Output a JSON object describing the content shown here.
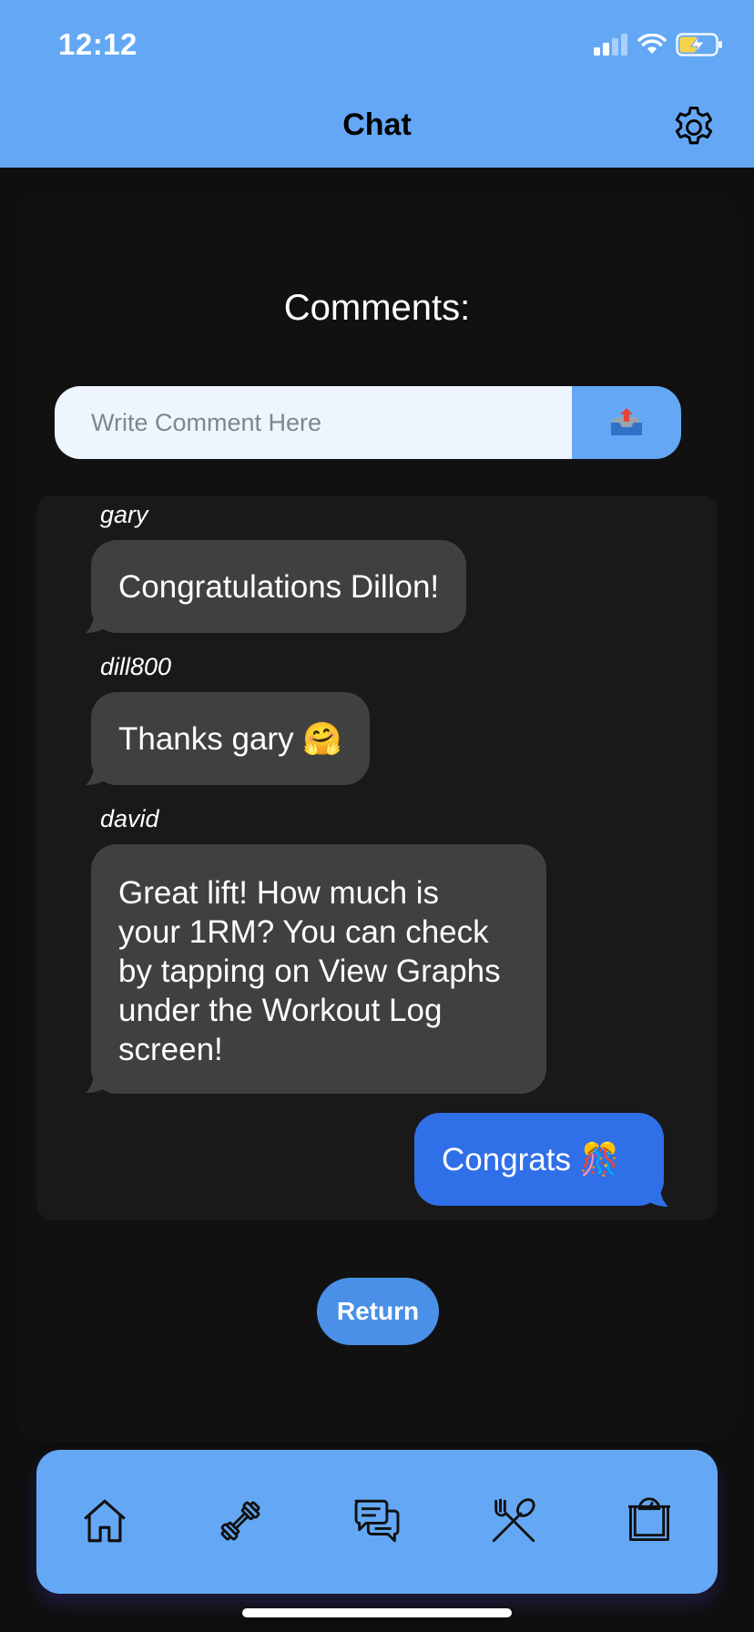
{
  "status_bar": {
    "time": "12:12"
  },
  "header": {
    "title": "Chat",
    "settings_icon": "gear-icon"
  },
  "comments": {
    "heading": "Comments:",
    "composer": {
      "placeholder": "Write Comment Here",
      "value": "",
      "send_icon": "outbox-tray-icon"
    },
    "messages": [
      {
        "author": "gary",
        "text": "Congratulations Dillon!",
        "direction": "incoming"
      },
      {
        "author": "dill800",
        "text": "Thanks gary 🤗",
        "direction": "incoming"
      },
      {
        "author": "david",
        "lines": [
          "Great lift! How much is",
          "your 1RM? You can check",
          "by tapping on View Graphs",
          "under the Workout Log",
          "screen!"
        ],
        "direction": "incoming"
      },
      {
        "author": "",
        "text": "Congrats 🎊",
        "direction": "outgoing"
      }
    ]
  },
  "return_label": "Return",
  "tabbar": {
    "items": [
      "home-icon",
      "dumbbell-icon",
      "chat-bubbles-icon",
      "fork-spoon-icon",
      "scale-icon"
    ]
  },
  "colors": {
    "header": "#64a8f5",
    "incoming_bubble": "#404040",
    "outgoing_bubble": "#2f6fe8",
    "background": "#0f0f0f"
  }
}
